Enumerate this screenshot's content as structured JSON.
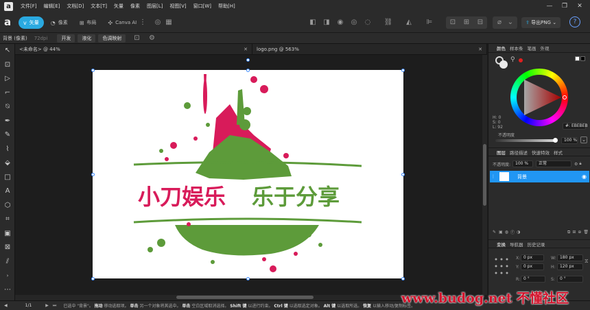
{
  "menubar": {
    "logo_glyph": "a",
    "items": [
      "文件[F]",
      "编辑[E]",
      "文档[D]",
      "文本[T]",
      "矢量",
      "像素",
      "图层[L]",
      "视图[V]",
      "窗口[W]",
      "帮助[H]"
    ],
    "window_controls": [
      "—",
      "❐",
      "✕"
    ]
  },
  "toolbar": {
    "app_glyph": "a",
    "personas": [
      {
        "icon": "vector-persona-icon",
        "glyph": "ᴠ",
        "label": "矢量",
        "active": true
      },
      {
        "icon": "pixel-persona-icon",
        "glyph": "◔",
        "label": "像素",
        "active": false
      },
      {
        "icon": "layout-persona-icon",
        "glyph": "⊞",
        "label": "布局",
        "active": false
      },
      {
        "icon": "canva-ai-icon",
        "glyph": "✣",
        "label": "Canva AI",
        "active": false
      }
    ],
    "export_label": "导出PNG",
    "export_arrow": "⌄",
    "help_glyph": "?"
  },
  "contextbar": {
    "layer_label": "背景 (像素)",
    "dpi": "72dpi",
    "buttons": [
      "开发",
      "液化",
      "色调映射"
    ]
  },
  "doc_tabs": [
    {
      "title": "<未命名> @ 44%",
      "close": "✕"
    },
    {
      "title": "logo.png @ 563%",
      "close": "✕"
    }
  ],
  "color_panel": {
    "tabs": [
      "颜色",
      "样本条",
      "笔画",
      "外观"
    ],
    "h": "H: 0",
    "s": "S: 0",
    "l": "L: 92",
    "hex": "#: EBEBEB",
    "opacity_label": "不透明度",
    "opacity_value": "100 %",
    "accent": "#2196f3",
    "current_color": "#EBEBEB"
  },
  "layers_panel": {
    "tabs": [
      "图层",
      "路径描述",
      "快速特效",
      "样式"
    ],
    "opacity_label": "不透明度:",
    "opacity_value": "100 %",
    "blend_mode": "正常",
    "layer_name": "背景"
  },
  "transform_panel": {
    "tabs": [
      "变换",
      "导航器",
      "历史记录"
    ],
    "x_label": "X:",
    "x_value": "0 px",
    "y_label": "Y:",
    "y_value": "0 px",
    "w_label": "W:",
    "w_value": "180 px",
    "h_label": "H:",
    "h_value": "120 px",
    "r_label": "R:",
    "r_value": "0 °",
    "s_label": "S:",
    "s_value": "0 °"
  },
  "statusbar": {
    "page": "1/1",
    "segments": [
      {
        "text": "已选中 \"背景\"。"
      },
      {
        "key": "拖动",
        "text": "移动选取项。"
      },
      {
        "key": "单击",
        "text": "另一个对象将其选中。"
      },
      {
        "key": "单击",
        "text": "空白区域取消选择。"
      },
      {
        "key": "Shift 键",
        "text": "以进行约束。"
      },
      {
        "key": "Ctrl 键",
        "text": "以选取选定对象。"
      },
      {
        "key": "Alt 键",
        "text": "以选取所选。"
      },
      {
        "key": "恢复",
        "text": "以输入移动/复制标签。"
      }
    ]
  },
  "artwork": {
    "line1": "小刀娱乐",
    "line2": "乐于分享",
    "pink": "#d81b5a",
    "green": "#5d9b3a"
  },
  "watermark": "www.budog.net 不懂社区"
}
